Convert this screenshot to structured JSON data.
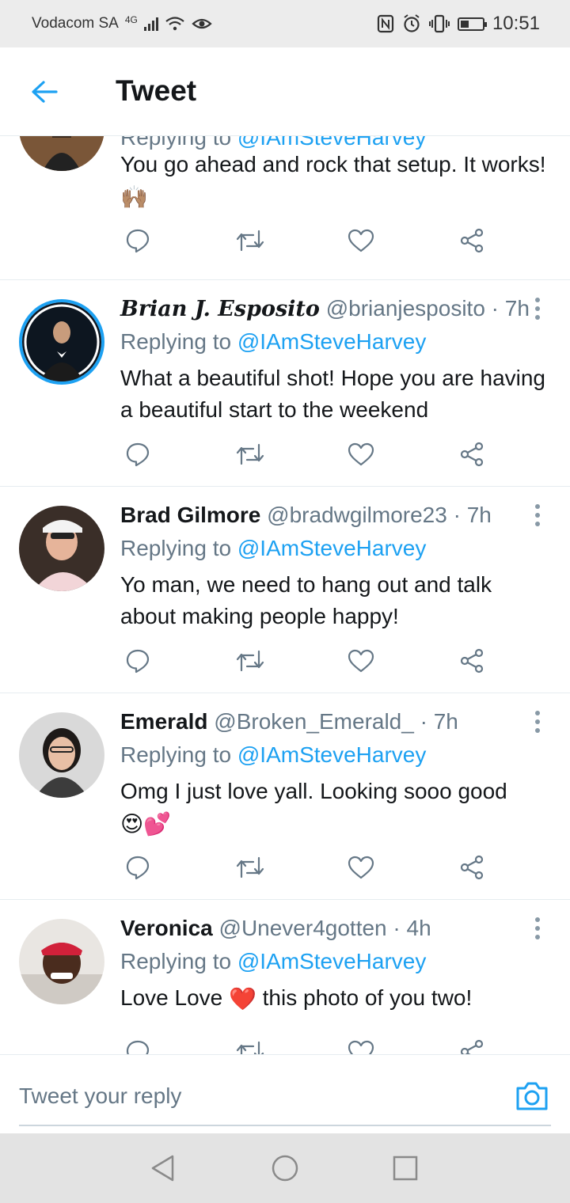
{
  "status_bar": {
    "carrier": "Vodacom SA",
    "network": "4G",
    "time": "10:51",
    "battery_level": 0.35,
    "icons": [
      "signal-bars-icon",
      "wifi-icon",
      "eye-comfort-icon",
      "nfc-icon",
      "alarm-icon",
      "vibrate-icon",
      "battery-icon"
    ]
  },
  "header": {
    "title": "Tweet",
    "back_icon": "back-arrow-icon"
  },
  "tweets": [
    {
      "name": "",
      "handle": "",
      "time": "",
      "replying_prefix": "Replying to",
      "replying_to": "@IAmSteveHarvey",
      "text": "You go ahead and rock that setup. It works!",
      "emoji": "🙌🏽"
    },
    {
      "name": "Brian J. Esposito",
      "handle": "@brianjesposito · 7h",
      "replying_prefix": "Replying to",
      "replying_to": "@IAmSteveHarvey",
      "text": "What a beautiful shot! Hope you are having a beautiful start to the weekend",
      "emoji": ""
    },
    {
      "name": "Brad Gilmore",
      "handle": "@bradwgilmore23 · 7h",
      "replying_prefix": "Replying to",
      "replying_to": "@IAmSteveHarvey",
      "text": "Yo man, we need to hang out and talk about making people happy!",
      "emoji": ""
    },
    {
      "name": "Emerald",
      "handle": "@Broken_Emerald_ · 7h",
      "replying_prefix": "Replying to",
      "replying_to": "@IAmSteveHarvey",
      "text": "Omg I just love yall. Looking sooo good",
      "emoji": "😍💕"
    },
    {
      "name": "Veronica",
      "handle": "@Unever4gotten · 4h",
      "replying_prefix": "Replying to",
      "replying_to": "@IAmSteveHarvey",
      "text_before": "Love Love",
      "text_emoji": "❤️",
      "text_after": "this photo of you two!"
    }
  ],
  "action_icons": [
    "reply-icon",
    "retweet-icon",
    "like-icon",
    "share-icon"
  ],
  "reply_bar": {
    "placeholder": "Tweet your reply",
    "camera_icon": "camera-icon"
  },
  "nav_bar": {
    "icons": [
      "back-triangle-icon",
      "home-circle-icon",
      "recents-square-icon"
    ]
  },
  "colors": {
    "accent": "#1da1f2",
    "secondary_text": "#657786",
    "primary_text": "#14171a",
    "divider": "#e6ecf0"
  }
}
